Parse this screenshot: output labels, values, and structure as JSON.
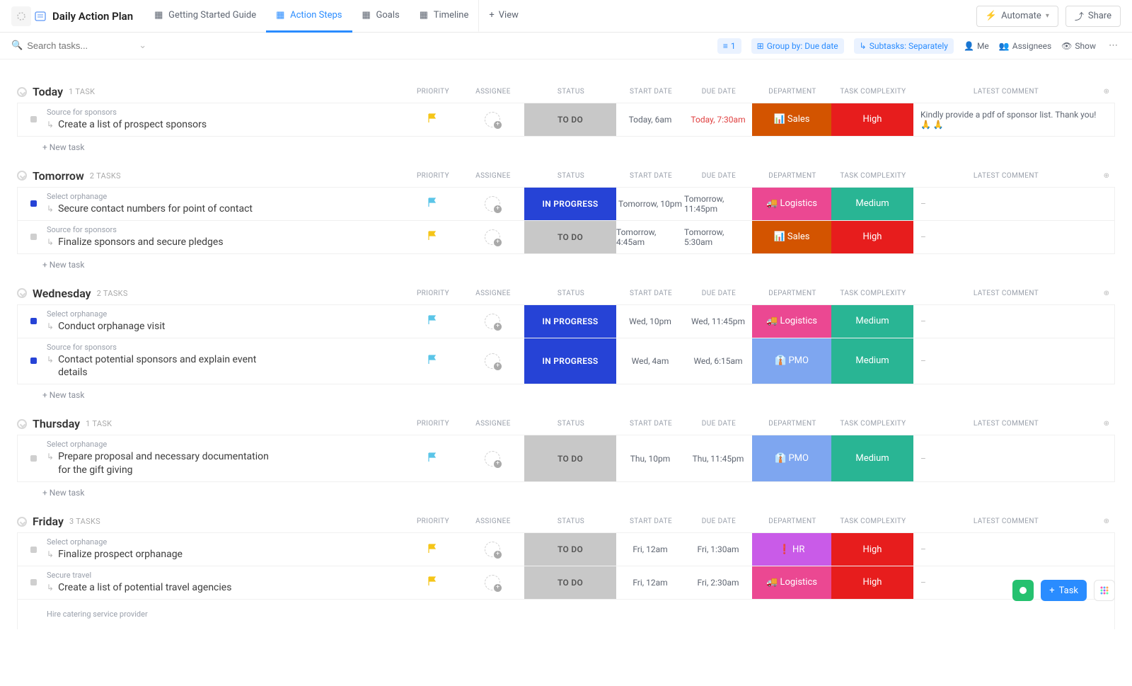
{
  "header": {
    "title": "Daily Action Plan",
    "tabs": [
      {
        "label": "Getting Started Guide",
        "icon": "doc-icon"
      },
      {
        "label": "Action Steps",
        "icon": "list-icon",
        "active": true
      },
      {
        "label": "Goals",
        "icon": "target-icon"
      },
      {
        "label": "Timeline",
        "icon": "timeline-icon"
      }
    ],
    "add_view": "View",
    "automate": "Automate",
    "share": "Share"
  },
  "toolbar": {
    "search_placeholder": "Search tasks...",
    "filter_count": "1",
    "group_by": "Group by: Due date",
    "subtasks": "Subtasks: Separately",
    "me": "Me",
    "assignees": "Assignees",
    "show": "Show"
  },
  "columns": {
    "priority": "PRIORITY",
    "assignee": "ASSIGNEE",
    "status": "STATUS",
    "start_date": "START DATE",
    "due_date": "DUE DATE",
    "department": "DEPARTMENT",
    "task_complexity": "TASK COMPLEXITY",
    "latest_comment": "LATEST COMMENT"
  },
  "new_task_label": "+ New task",
  "groups": [
    {
      "title": "Today",
      "count": "1 TASK",
      "tasks": [
        {
          "square": "grey",
          "parent": "Source for sponsors",
          "title": "Create a list of prospect sponsors",
          "flag": "yellow",
          "status": "TO DO",
          "status_class": "st-todo",
          "start": "Today, 6am",
          "due": "Today, 7:30am",
          "due_overdue": true,
          "dept": "Sales",
          "dept_emoji": "📊",
          "dept_class": "dept-sales",
          "complex": "High",
          "complex_class": "cx-high",
          "comment": "Kindly provide a pdf of sponsor list. Thank you! 🙏 🙏"
        }
      ]
    },
    {
      "title": "Tomorrow",
      "count": "2 TASKS",
      "tasks": [
        {
          "square": "blue",
          "parent": "Select orphanage",
          "title": "Secure contact numbers for point of contact",
          "flag": "cyan",
          "status": "IN PROGRESS",
          "status_class": "st-progress",
          "start": "Tomorrow, 10pm",
          "due": "Tomorrow, 11:45pm",
          "dept": "Logistics",
          "dept_emoji": "🚚",
          "dept_class": "dept-logistics",
          "complex": "Medium",
          "complex_class": "cx-medium",
          "comment": "–"
        },
        {
          "square": "grey",
          "parent": "Source for sponsors",
          "title": "Finalize sponsors and secure pledges",
          "flag": "yellow",
          "status": "TO DO",
          "status_class": "st-todo",
          "start": "Tomorrow, 4:45am",
          "due": "Tomorrow, 5:30am",
          "dept": "Sales",
          "dept_emoji": "📊",
          "dept_class": "dept-sales",
          "complex": "High",
          "complex_class": "cx-high",
          "comment": "–"
        }
      ]
    },
    {
      "title": "Wednesday",
      "count": "2 TASKS",
      "tasks": [
        {
          "square": "blue",
          "parent": "Select orphanage",
          "title": "Conduct orphanage visit",
          "flag": "cyan",
          "status": "IN PROGRESS",
          "status_class": "st-progress",
          "start": "Wed, 10pm",
          "due": "Wed, 11:45pm",
          "dept": "Logistics",
          "dept_emoji": "🚚",
          "dept_class": "dept-logistics",
          "complex": "Medium",
          "complex_class": "cx-medium",
          "comment": "–"
        },
        {
          "square": "blue",
          "parent": "Source for sponsors",
          "title": "Contact potential sponsors and explain event details",
          "flag": "cyan",
          "status": "IN PROGRESS",
          "status_class": "st-progress",
          "start": "Wed, 4am",
          "due": "Wed, 6:15am",
          "dept": "PMO",
          "dept_emoji": "👔",
          "dept_class": "dept-pmo",
          "complex": "Medium",
          "complex_class": "cx-medium",
          "comment": "–"
        }
      ]
    },
    {
      "title": "Thursday",
      "count": "1 TASK",
      "tasks": [
        {
          "square": "grey",
          "parent": "Select orphanage",
          "title": "Prepare proposal and necessary documentation for the gift giving",
          "flag": "cyan",
          "status": "TO DO",
          "status_class": "st-todo",
          "start": "Thu, 10pm",
          "due": "Thu, 11:45pm",
          "dept": "PMO",
          "dept_emoji": "👔",
          "dept_class": "dept-pmo",
          "complex": "Medium",
          "complex_class": "cx-medium",
          "comment": "–"
        }
      ]
    },
    {
      "title": "Friday",
      "count": "3 TASKS",
      "no_new_task": true,
      "tasks": [
        {
          "square": "grey",
          "parent": "Select orphanage",
          "title": "Finalize prospect orphanage",
          "flag": "yellow",
          "status": "TO DO",
          "status_class": "st-todo",
          "start": "Fri, 12am",
          "due": "Fri, 1:30am",
          "dept": "HR",
          "dept_emoji": "❗",
          "dept_class": "dept-hr",
          "complex": "High",
          "complex_class": "cx-high",
          "comment": "–"
        },
        {
          "square": "grey",
          "parent": "Secure travel",
          "title": "Create a list of potential travel agencies",
          "flag": "yellow",
          "status": "TO DO",
          "status_class": "st-todo",
          "start": "Fri, 12am",
          "due": "Fri, 2:30am",
          "dept": "Logistics",
          "dept_emoji": "🚚",
          "dept_class": "dept-logistics",
          "complex": "High",
          "complex_class": "cx-high",
          "comment": "–"
        },
        {
          "partial": true,
          "parent": "Hire catering service provider"
        }
      ]
    }
  ],
  "fab": {
    "task": "Task"
  }
}
